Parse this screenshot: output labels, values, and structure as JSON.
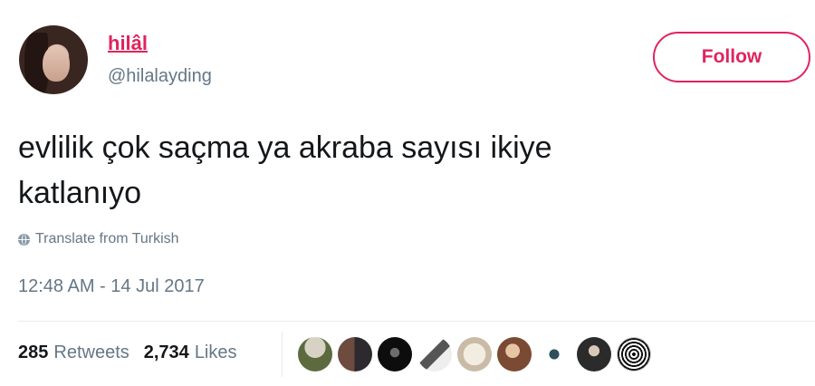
{
  "user": {
    "name": "hilâl",
    "handle": "@hilalayding"
  },
  "follow_label": "Follow",
  "tweet": {
    "text_line1": "evlilik çok saçma ya akraba sayısı ikiye",
    "text_line2": "katlanıyo",
    "translate_label": "Translate from Turkish",
    "timestamp": "12:48 AM - 14 Jul 2017"
  },
  "stats": {
    "retweets_count": "285",
    "retweets_label": "Retweets",
    "likes_count": "2,734",
    "likes_label": "Likes"
  },
  "colors": {
    "accent": "#e0245e",
    "secondary_text": "#657786",
    "primary_text": "#14171a"
  }
}
